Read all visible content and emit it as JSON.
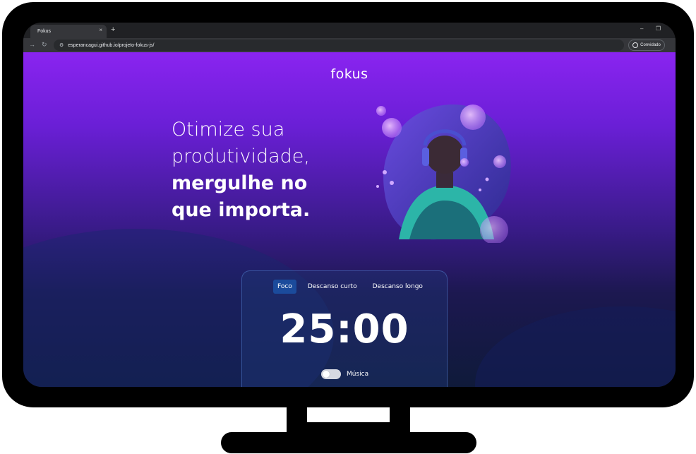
{
  "browser": {
    "tab_title": "Fokus",
    "tab_close": "×",
    "new_tab": "+",
    "url": "esperancagui.github.io/projeto-fokus-js/",
    "profile_label": "Convidado",
    "minimize": "–",
    "maximize": "❐"
  },
  "page": {
    "logo": "fokus",
    "headline": {
      "line1": "Otimize sua",
      "line2": "produtividade,",
      "line3": "mergulhe no",
      "line4": "que importa."
    },
    "modes": [
      "Foco",
      "Descanso curto",
      "Descanso longo"
    ],
    "active_mode": "Foco",
    "timer": "25:00",
    "music_label": "Música",
    "music_on": false
  },
  "colors": {
    "gradient_top": "#8a24f0",
    "gradient_bottom": "#0f1a3a",
    "active_mode_bg": "#1b4b9c"
  }
}
